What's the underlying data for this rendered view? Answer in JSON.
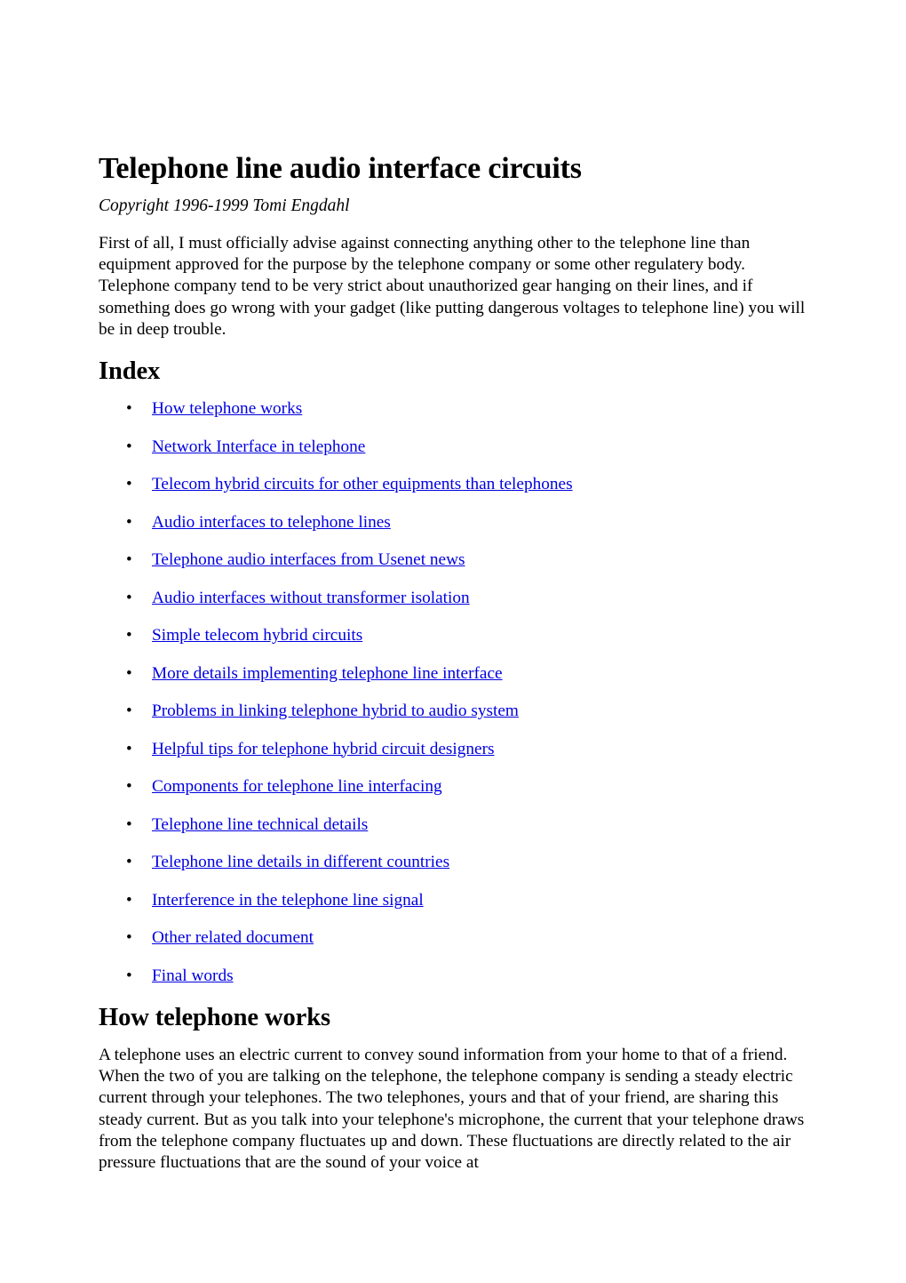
{
  "document": {
    "title": "Telephone line audio interface circuits",
    "byline": "Copyright 1996-1999 Tomi Engdahl",
    "intro_paragraph": "First of all, I must officially advise against connecting anything other to the telephone line than equipment approved for the purpose by the telephone company or some other regulatery body. Telephone company tend to be very strict about unauthorized gear hanging on their lines, and if something does go wrong with your gadget (like putting dangerous voltages to telephone line) you will be in deep trouble."
  },
  "index": {
    "heading": "Index",
    "bullet_glyph": "•",
    "link_color": "#0000e0",
    "items": [
      {
        "label": "How telephone works"
      },
      {
        "label": "Network Interface in telephone"
      },
      {
        "label": "Telecom hybrid circuits for other equipments than telephones"
      },
      {
        "label": "Audio interfaces to telephone lines"
      },
      {
        "label": "Telephone audio interfaces from Usenet news"
      },
      {
        "label": "Audio interfaces without transformer isolation"
      },
      {
        "label": "Simple telecom hybrid circuits"
      },
      {
        "label": "More details implementing telephone line interface"
      },
      {
        "label": "Problems in linking telephone hybrid to audio system"
      },
      {
        "label": "Helpful tips for telephone hybrid circuit designers"
      },
      {
        "label": "Components for telephone line interfacing"
      },
      {
        "label": "Telephone line technical details"
      },
      {
        "label": "Telephone line details in different countries"
      },
      {
        "label": "Interference in the telephone line signal"
      },
      {
        "label": "Other related document"
      },
      {
        "label": "Final words"
      }
    ]
  },
  "how_telephone_works": {
    "heading": "How telephone works",
    "paragraph": "A telephone uses an electric current to convey sound information from your home to that of a friend. When the two of you are talking on the telephone, the telephone company is sending a steady electric current through your telephones. The two telephones, yours and that of your friend, are sharing this steady current. But as you talk into your telephone's microphone, the current that your telephone draws from the telephone company fluctuates up and down. These fluctuations are directly related to the air pressure fluctuations that are the sound of your voice at"
  }
}
